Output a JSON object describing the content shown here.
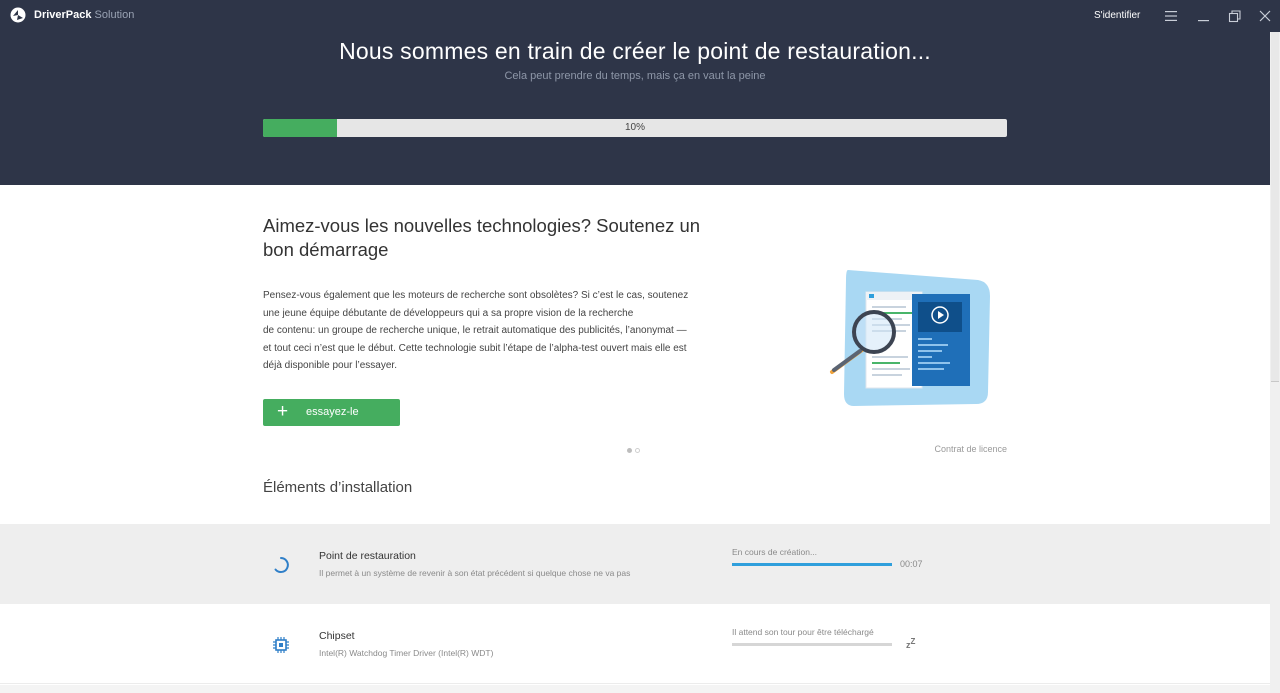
{
  "app": {
    "brand_bold": "DriverPack",
    "brand_light": " Solution"
  },
  "titlebar": {
    "signin": "S'identifier"
  },
  "header": {
    "title": "Nous sommes en train de créer le point de restauration...",
    "subtitle": "Cela peut prendre du temps, mais ça en vaut la peine",
    "progress_percent": 10,
    "progress_label": "10%"
  },
  "promo": {
    "title": "Aimez-vous les nouvelles technologies? Soutenez un bon démarrage",
    "lines": [
      "Pensez-vous également que les moteurs de recherche sont obsolètes? Si c’est le cas, soutenez",
      "une jeune équipe débutante de développeurs qui a sa propre vision de la recherche",
      "de contenu: un groupe de recherche unique, le retrait automatique des publicités, l’anonymat —",
      "et tout ceci n’est que le début. Cette technologie subit l’étape de l’alpha-test ouvert mais elle est",
      "déjà disponible pour l’essayer."
    ],
    "button": "essayez-le",
    "license": "Contrat de licence"
  },
  "section_title": "Éléments d’installation",
  "items": [
    {
      "name": "Point de restauration",
      "desc": "Il permet à un système de revenir à son état précédent si quelque chose ne va pas",
      "status": "En cours de création...",
      "progress": 1.0,
      "time": "00:07",
      "icon": "spinner-icon"
    },
    {
      "name": "Chipset",
      "desc": "Intel(R) Watchdog Timer Driver (Intel(R) WDT)",
      "status": "Il attend son tour pour être téléchargé",
      "progress": 0,
      "waiting": "z",
      "waiting_sup": "Z",
      "icon": "chip-icon"
    }
  ],
  "colors": {
    "header_bg": "#2e3548",
    "accent_green": "#45ad5f",
    "accent_blue": "#2f9fdc"
  }
}
